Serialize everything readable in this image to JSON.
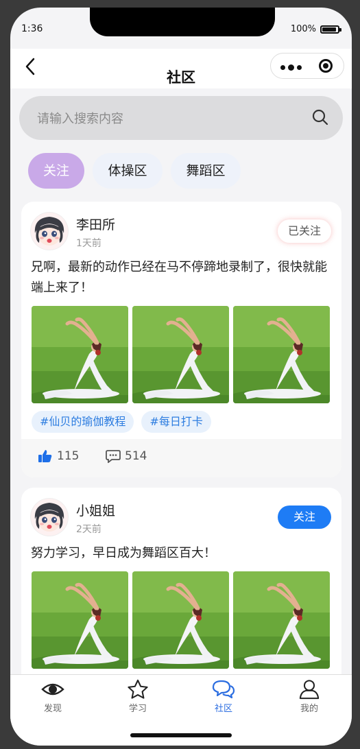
{
  "status": {
    "time": "1:36",
    "battery": "100%"
  },
  "nav": {
    "title": "社区"
  },
  "search": {
    "placeholder": "请输入搜索内容"
  },
  "tabs": [
    {
      "label": "关注",
      "active": true
    },
    {
      "label": "体操区",
      "active": false
    },
    {
      "label": "舞蹈区",
      "active": false
    }
  ],
  "posts": [
    {
      "user": "李田所",
      "time": "1天前",
      "follow_label": "已关注",
      "text": "兄啊，最新的动作已经在马不停蹄地录制了，很快就能端上来了！",
      "tags": [
        "#仙贝的瑜伽教程",
        "#每日打卡"
      ],
      "likes": "115",
      "comments": "514"
    },
    {
      "user": "小姐姐",
      "time": "2天前",
      "follow_label": "关注",
      "text": "努力学习，早日成为舞蹈区百大！"
    }
  ],
  "tabbar": [
    {
      "label": "发现",
      "icon": "eye-icon"
    },
    {
      "label": "学习",
      "icon": "star-icon"
    },
    {
      "label": "社区",
      "icon": "chat-icon",
      "active": true
    },
    {
      "label": "我的",
      "icon": "user-icon"
    }
  ],
  "colors": {
    "accent": "#1e7cf5",
    "tab_active": "#c9a9e8"
  }
}
